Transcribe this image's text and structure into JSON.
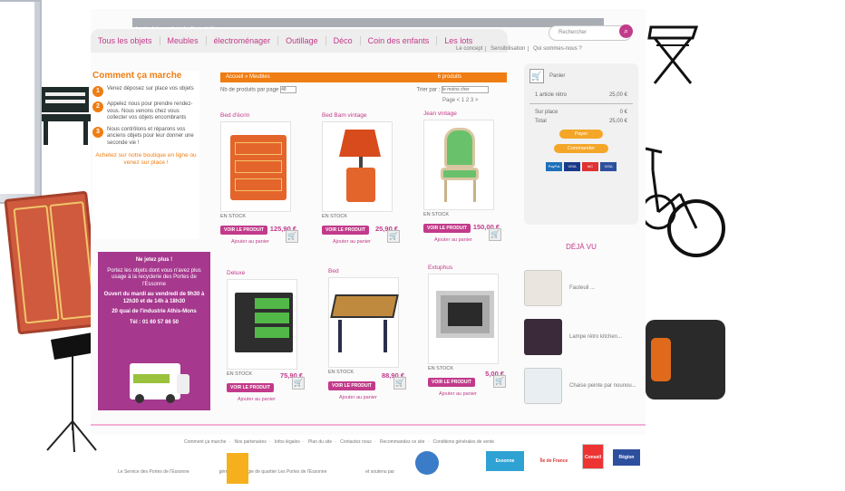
{
  "site": {
    "tagline": "Le site de la recyclerie des Hauts de Vienne",
    "nav": [
      "Tous les objets",
      "Meubles",
      "électroménager",
      "Outillage",
      "Déco",
      "Coin des enfants",
      "Les lots"
    ],
    "search_placeholder": "Rechercher",
    "top_links": [
      "Le concept",
      "Sensibilisation",
      "Qui sommes-nous ?"
    ]
  },
  "how_it_works": {
    "title": "Comment ça marche",
    "steps": [
      "Venez déposez sur place vos objets",
      "Appelez nous pour prendre rendez-vous. Nous venons chez vous collecter vos objets encombrants",
      "Nous contrôlons et réparons vos anciens objets pour leur donner une seconde vie !"
    ],
    "cta": "Achetez sur notre boutique en ligne ou venez sur place !"
  },
  "promo": {
    "lines": [
      "Ne jetez plus !",
      "Portez les objets dont vous n'avez plus usage à la recyclerie des Portes de l'Essonne",
      "Ouvert du mardi au vendredi de 9h30 à 12h30 et de 14h à 18h30",
      "20 quai de l'industrie Athis-Mons",
      "Tél : 01 60 57 86 50"
    ]
  },
  "catalog": {
    "breadcrumb": "Accueil » Meubles",
    "count": "6 produits",
    "per_page_label": "Nb de produits par page",
    "per_page_value": "48",
    "sort_label": "Trier par :",
    "sort_value": "le moins cher",
    "pages": "Page < 1 2 3 >",
    "stock_label": "EN STOCK",
    "view_label": "VOIR LE PRODUIT",
    "add_label": "Ajouter au panier",
    "products": [
      {
        "name": "Bed d'écrin",
        "price": "125,90 €"
      },
      {
        "name": "Bed Bam vintage",
        "price": "25,90 €"
      },
      {
        "name": "Jean vintage",
        "price": "150,00 €"
      },
      {
        "name": "Deluxe",
        "price": "75,90 €"
      },
      {
        "name": "Bed",
        "price": "88,90 €"
      },
      {
        "name": "Extuphus",
        "price": "5,00 €"
      }
    ]
  },
  "cart": {
    "title": "Panier",
    "rows": [
      {
        "label": "1 article rétro",
        "value": "25,00 €"
      },
      {
        "label": "Sur place",
        "value": "0 €"
      },
      {
        "label": "Total",
        "value": "25,00 €"
      }
    ],
    "btn_pay": "Payer",
    "btn_order": "Commander",
    "payments": [
      "PayPal",
      "VISA",
      "MC",
      "VISA"
    ]
  },
  "seen": {
    "title": "DÉJÀ VU",
    "items": [
      "Fauteuil ...",
      "Lampe rétro kitchen...",
      "Chaise peinte par nounou..."
    ]
  },
  "footer": {
    "links": [
      "Comment ça marche",
      "Nos partenaires",
      "Infos légales",
      "Plan du site",
      "Contactez nous",
      "Recommandez ce site",
      "Conditions générales de vente"
    ],
    "credit_left": "Le Service des Portes de l'Essonne",
    "credit_mid": "géré par la Régie de quartier Les Portes de l'Essonne",
    "credit_right": "et soutenu par",
    "logos": [
      "Essonne",
      "Île de France",
      "Conseil",
      "Région"
    ]
  },
  "colors": {
    "brand": "#c23a8a",
    "accent": "#ef7d13",
    "promo": "#a6388e"
  }
}
